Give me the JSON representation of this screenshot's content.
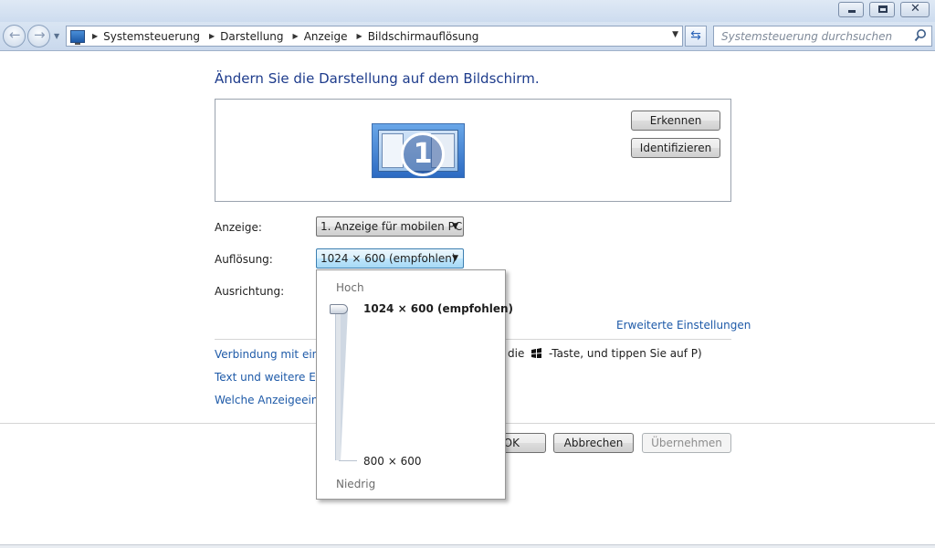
{
  "window": {
    "minimize": "minimize",
    "maximize": "restore",
    "close": "close"
  },
  "breadcrumb": [
    "Systemsteuerung",
    "Darstellung",
    "Anzeige",
    "Bildschirmauflösung"
  ],
  "search": {
    "placeholder": "Systemsteuerung durchsuchen"
  },
  "main": {
    "heading": "Ändern Sie die Darstellung auf dem Bildschirm.",
    "monitor_number": "1",
    "detect_button": "Erkennen",
    "identify_button": "Identifizieren",
    "display_label": "Anzeige:",
    "display_value": "1. Anzeige für mobilen PC",
    "resolution_label": "Auflösung:",
    "resolution_value": "1024 × 600 (empfohlen)",
    "orientation_label": "Ausrichtung:",
    "advanced_link": "Erweiterte Einstellungen",
    "link_projector": "Verbindung mit einer",
    "link_projector_hint_pre": "die",
    "link_projector_hint_post": "-Taste, und tippen Sie auf P)",
    "link_text_size": "Text und weitere Elen",
    "link_which_settings": "Welche Anzeigeeinste"
  },
  "footer": {
    "ok": "OK",
    "cancel": "Abbrechen",
    "apply": "Übernehmen"
  },
  "resolution_popup": {
    "high_label": "Hoch",
    "low_label": "Niedrig",
    "max_option": "1024 × 600 (empfohlen)",
    "min_option": "800 × 600",
    "selected_level": 1.0
  },
  "colors": {
    "link": "#1e5aa8",
    "heading": "#1e3c8c",
    "combo_active": "#bee6fd"
  }
}
